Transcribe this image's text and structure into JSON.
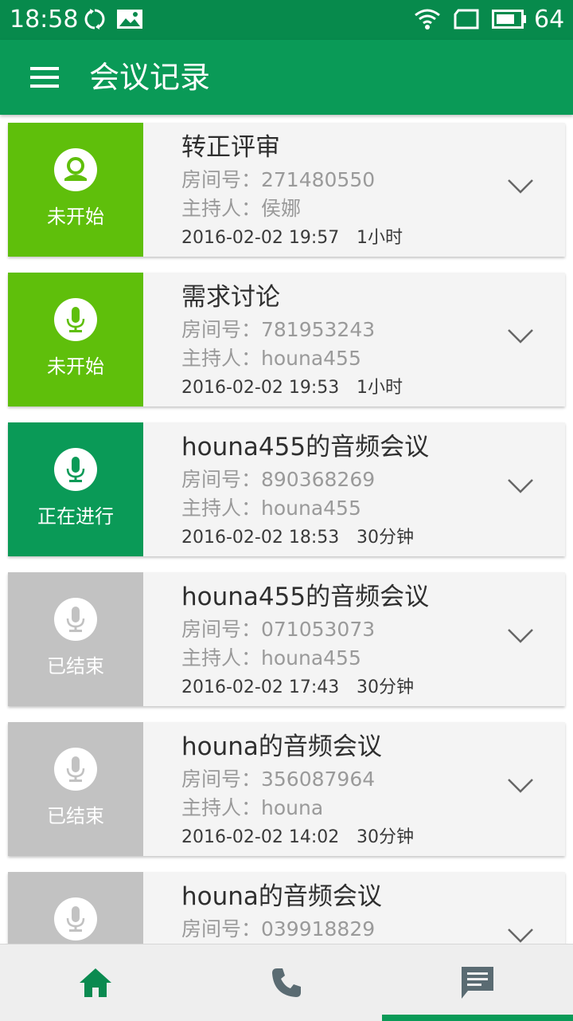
{
  "status_bar": {
    "time": "18:58",
    "battery": "64",
    "icons": [
      "sync-icon",
      "gallery-icon",
      "wifi-icon",
      "sim-icon",
      "battery-icon"
    ]
  },
  "app_bar": {
    "title": "会议记录",
    "menu_icon": "menu-icon"
  },
  "colors": {
    "app_bar": "#0a9a57",
    "status_bar": "#078a4c",
    "pending": "#5fbf0b",
    "active": "#0a9a57",
    "ended": "#c2c2c2"
  },
  "meetings": [
    {
      "status": "未开始",
      "state": "pending",
      "icon": "contact-icon",
      "title": "转正评审",
      "room": "房间号：271480550",
      "host": "主持人：侯娜",
      "time": "2016-02-02 19:57",
      "duration": "1小时"
    },
    {
      "status": "未开始",
      "state": "pending",
      "icon": "mic-icon",
      "title": "需求讨论",
      "room": "房间号：781953243",
      "host": "主持人：houna455",
      "time": "2016-02-02 19:53",
      "duration": "1小时"
    },
    {
      "status": "正在进行",
      "state": "active",
      "icon": "mic-icon",
      "title": "houna455的音频会议",
      "room": "房间号：890368269",
      "host": "主持人：houna455",
      "time": "2016-02-02 18:53",
      "duration": "30分钟"
    },
    {
      "status": "已结束",
      "state": "ended",
      "icon": "mic-icon",
      "title": "houna455的音频会议",
      "room": "房间号：071053073",
      "host": "主持人：houna455",
      "time": "2016-02-02 17:43",
      "duration": "30分钟"
    },
    {
      "status": "已结束",
      "state": "ended",
      "icon": "mic-icon",
      "title": "houna的音频会议",
      "room": "房间号：356087964",
      "host": "主持人：houna",
      "time": "2016-02-02 14:02",
      "duration": "30分钟"
    },
    {
      "status": "",
      "state": "ended",
      "icon": "mic-icon",
      "title": "houna的音频会议",
      "room": "房间号：039918829",
      "host": "",
      "time": "",
      "duration": ""
    }
  ],
  "bottom_nav": {
    "tabs": [
      {
        "icon": "home-icon",
        "color": "#0a8a50"
      },
      {
        "icon": "phone-icon",
        "color": "#5a6b72"
      },
      {
        "icon": "message-icon",
        "color": "#5a6b72"
      }
    ],
    "selected_index": 2
  }
}
